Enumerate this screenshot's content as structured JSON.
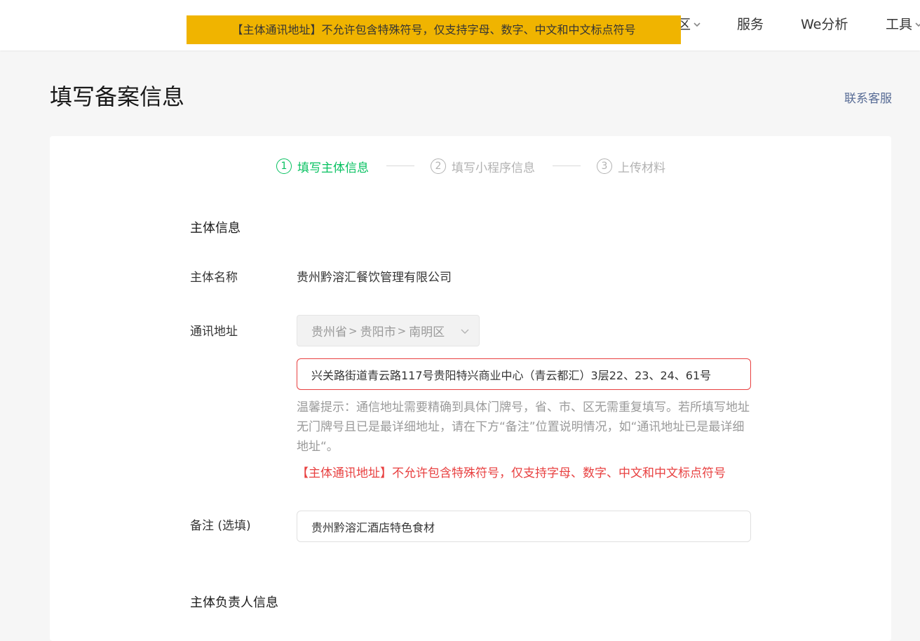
{
  "topnav": {
    "partial_item_label": "区",
    "items": [
      {
        "label": "服务"
      },
      {
        "label": "We分析"
      },
      {
        "label": "工具"
      }
    ]
  },
  "toast": {
    "text": "【主体通讯地址】不允许包含特殊符号，仅支持字母、数字、中文和中文标点符号",
    "color": "#f0b400"
  },
  "header": {
    "title": "填写备案信息",
    "contact_label": "联系客服"
  },
  "steps": [
    {
      "number": "1",
      "label": "填写主体信息",
      "active": true
    },
    {
      "number": "2",
      "label": "填写小程序信息",
      "active": false
    },
    {
      "number": "3",
      "label": "上传材料",
      "active": false
    }
  ],
  "subject_section": {
    "title": "主体信息",
    "name_label": "主体名称",
    "name_value": "贵州黔溶汇餐饮管理有限公司",
    "address_label": "通讯地址",
    "region": {
      "province": "贵州省",
      "city": "贵阳市",
      "district": "南明区"
    },
    "address_value": "兴关路街道青云路117号贵阳特兴商业中心（青云都汇）3层22、23、24、61号",
    "hint": "温馨提示：通信地址需要精确到具体门牌号，省、市、区无需重复填写。若所填写地址无门牌号且已是最详细地址，请在下方“备注”位置说明情况，如“通讯地址已是最详细地址“。",
    "error": "【主体通讯地址】不允许包含特殊符号，仅支持字母、数字、中文和中文标点符号",
    "remark_label": "备注 (选填)",
    "remark_value": "贵州黔溶汇酒店特色食材"
  },
  "owner_section": {
    "title": "主体负责人信息"
  },
  "colors": {
    "accent": "#07c160",
    "error": "#e84040",
    "link": "#576b95",
    "toast": "#f0b400"
  }
}
